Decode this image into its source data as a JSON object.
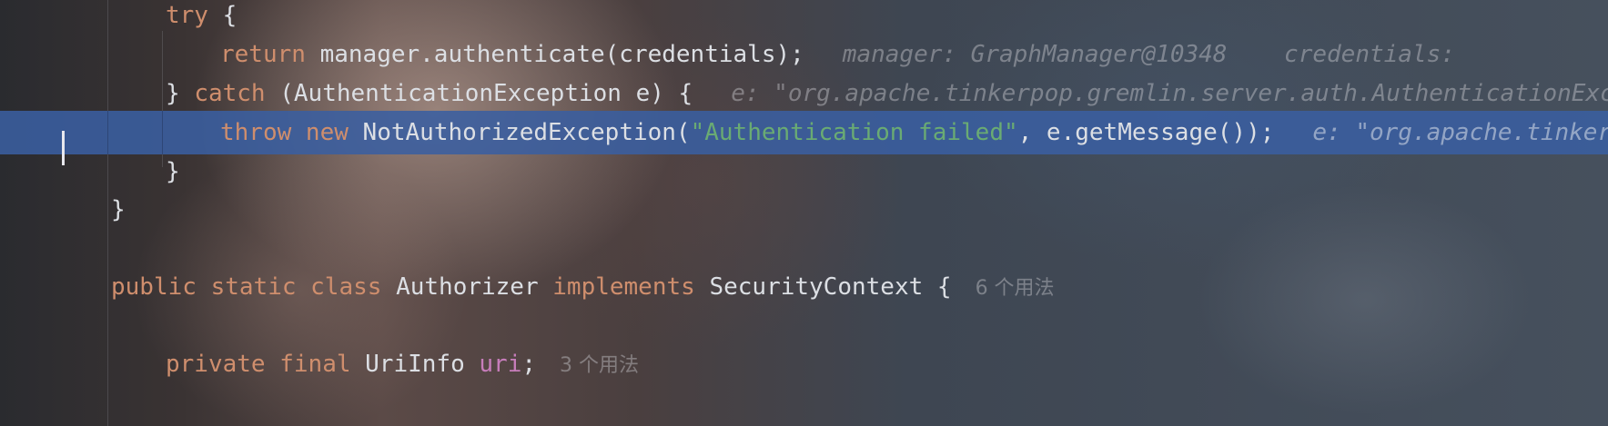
{
  "colors": {
    "keyword": "#cf8e6d",
    "string": "#6aab73",
    "field": "#c77dbb",
    "text": "#dcdfe4",
    "hint": "#9b9ba2",
    "selection": "#3a5fa0"
  },
  "code": {
    "line1": {
      "kw_try": "try",
      "brace": " {"
    },
    "line2": {
      "kw_return": "return",
      "expr": " manager.authenticate(credentials);",
      "hint": "manager: GraphManager@10348    credentials: "
    },
    "line3": {
      "close": "} ",
      "kw_catch": "catch",
      "rest": " (AuthenticationException e) {",
      "hint": "e: \"org.apache.tinkerpop.gremlin.server.auth.AuthenticationException"
    },
    "line4": {
      "kw_throw": "throw",
      "kw_new": " new",
      "call_start": " NotAuthorizedException(",
      "string": "\"Authentication failed\"",
      "call_end": ", e.getMessage());",
      "hint": "e: \"org.apache.tinkerpop.gremlin"
    },
    "line5": {
      "brace": "}"
    },
    "line6": {
      "brace": "}"
    },
    "line8": {
      "kw_public": "public",
      "kw_static": " static",
      "kw_class": " class",
      "name": " Authorizer",
      "kw_implements": " implements",
      "iface": " SecurityContext {",
      "usages": "6 个用法"
    },
    "line10": {
      "kw_private": "private",
      "kw_final": " final",
      "type": " UriInfo ",
      "field": "uri",
      "semi": ";",
      "usages": "3 个用法"
    }
  }
}
